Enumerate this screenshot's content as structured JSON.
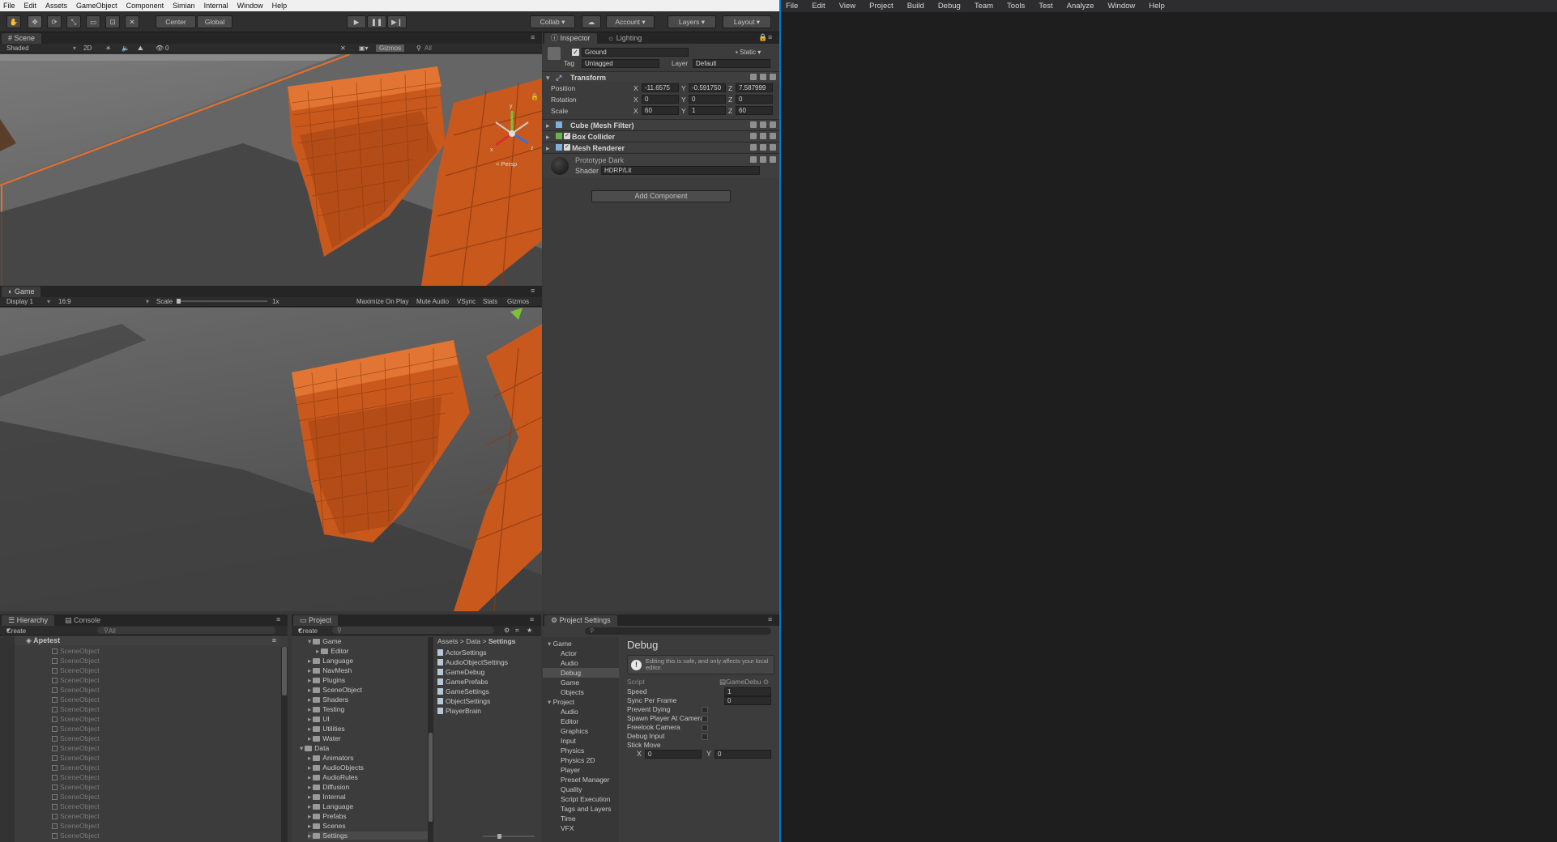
{
  "unity_menu": [
    "File",
    "Edit",
    "Assets",
    "GameObject",
    "Component",
    "Simian",
    "Internal",
    "Window",
    "Help"
  ],
  "toolbar": {
    "pivot": "Center",
    "space": "Global",
    "collab": "Collab",
    "account": "Account",
    "layers": "Layers",
    "layout": "Layout"
  },
  "scene": {
    "tab": "Scene",
    "shading": "Shaded",
    "mode_2d": "2D",
    "gizmos": "Gizmos",
    "search": "All",
    "persp": "Persp",
    "layer_count": "0",
    "axes": [
      "y",
      "x",
      "z"
    ]
  },
  "game": {
    "tab": "Game",
    "display": "Display 1",
    "aspect": "16:9",
    "scale_label": "Scale",
    "scale_value": "1x",
    "options": [
      "Maximize On Play",
      "Mute Audio",
      "VSync",
      "Stats",
      "Gizmos"
    ]
  },
  "inspector": {
    "tab": "Inspector",
    "tab2": "Lighting",
    "object_name": "Ground",
    "static_label": "Static",
    "tag_label": "Tag",
    "tag_value": "Untagged",
    "layer_label": "Layer",
    "layer_value": "Default",
    "transform": {
      "title": "Transform",
      "position_label": "Position",
      "rotation_label": "Rotation",
      "scale_label": "Scale",
      "position": [
        "-11.6575",
        "-0.591750",
        "7.587999"
      ],
      "rotation": [
        "0",
        "0",
        "0"
      ],
      "scale": [
        "60",
        "1",
        "60"
      ]
    },
    "components": [
      "Cube (Mesh Filter)",
      "Box Collider",
      "Mesh Renderer"
    ],
    "material_name": "Prototype Dark",
    "shader_label": "Shader",
    "shader_value": "HDRP/Lit",
    "add_component": "Add Component"
  },
  "hierarchy": {
    "tab": "Hierarchy",
    "tab2": "Console",
    "create": "Create",
    "search": "All",
    "scene_name": "Apetest",
    "items": [
      "SceneObject",
      "SceneObject",
      "SceneObject",
      "SceneObject",
      "SceneObject",
      "SceneObject",
      "SceneObject",
      "SceneObject",
      "SceneObject",
      "SceneObject",
      "SceneObject",
      "SceneObject",
      "SceneObject",
      "SceneObject",
      "SceneObject",
      "SceneObject",
      "SceneObject",
      "SceneObject",
      "SceneObject",
      "SceneObject"
    ]
  },
  "project": {
    "tab": "Project",
    "create": "Create",
    "tree": [
      {
        "label": "Game",
        "depth": 1
      },
      {
        "label": "Editor",
        "depth": 2
      },
      {
        "label": "Language",
        "depth": 1
      },
      {
        "label": "NavMesh",
        "depth": 1
      },
      {
        "label": "Plugins",
        "depth": 1
      },
      {
        "label": "SceneObject",
        "depth": 1
      },
      {
        "label": "Shaders",
        "depth": 1
      },
      {
        "label": "Testing",
        "depth": 1
      },
      {
        "label": "UI",
        "depth": 1
      },
      {
        "label": "Utilities",
        "depth": 1
      },
      {
        "label": "Water",
        "depth": 1
      },
      {
        "label": "Data",
        "depth": 0
      },
      {
        "label": "Animators",
        "depth": 1
      },
      {
        "label": "AudioObjects",
        "depth": 1
      },
      {
        "label": "AudioRules",
        "depth": 1
      },
      {
        "label": "Diffusion",
        "depth": 1
      },
      {
        "label": "Internal",
        "depth": 1
      },
      {
        "label": "Language",
        "depth": 1
      },
      {
        "label": "Prefabs",
        "depth": 1
      },
      {
        "label": "Scenes",
        "depth": 1
      },
      {
        "label": "Settings",
        "depth": 1
      }
    ],
    "breadcrumb": [
      "Assets",
      "Data",
      "Settings"
    ],
    "files": [
      "ActorSettings",
      "AudioObjectSettings",
      "GameDebug",
      "GamePrefabs",
      "GameSettings",
      "ObjectSettings",
      "PlayerBrain"
    ]
  },
  "project_settings": {
    "tab": "Project Settings",
    "nav": [
      {
        "label": "Game",
        "depth": 0
      },
      {
        "label": "Actor",
        "depth": 1
      },
      {
        "label": "Audio",
        "depth": 1
      },
      {
        "label": "Debug",
        "depth": 1
      },
      {
        "label": "Game",
        "depth": 1
      },
      {
        "label": "Objects",
        "depth": 1
      },
      {
        "label": "Project",
        "depth": 0
      },
      {
        "label": "Audio",
        "depth": 1
      },
      {
        "label": "Editor",
        "depth": 1
      },
      {
        "label": "Graphics",
        "depth": 1
      },
      {
        "label": "Input",
        "depth": 1
      },
      {
        "label": "Physics",
        "depth": 1
      },
      {
        "label": "Physics 2D",
        "depth": 1
      },
      {
        "label": "Player",
        "depth": 1
      },
      {
        "label": "Preset Manager",
        "depth": 1
      },
      {
        "label": "Quality",
        "depth": 1
      },
      {
        "label": "Script Execution",
        "depth": 1
      },
      {
        "label": "Tags and Layers",
        "depth": 1
      },
      {
        "label": "Time",
        "depth": 1
      },
      {
        "label": "VFX",
        "depth": 1
      }
    ],
    "title": "Debug",
    "notice": "Editing this is safe, and only affects your local editor.",
    "script_label": "Script",
    "script_value": "GameDebu",
    "fields": [
      {
        "label": "Speed",
        "value": "1"
      },
      {
        "label": "Sync Per Frame",
        "value": "0"
      },
      {
        "label": "Prevent Dying",
        "value": ""
      },
      {
        "label": "Spawn Player At Camera",
        "value": ""
      },
      {
        "label": "Freelook Camera",
        "value": ""
      },
      {
        "label": "Debug Input",
        "value": ""
      },
      {
        "label": "Stick Move",
        "value": ""
      }
    ],
    "stick_x": "0",
    "stick_y": "0"
  },
  "ide_menu": [
    "File",
    "Edit",
    "View",
    "Project",
    "Build",
    "Debug",
    "Team",
    "Tools",
    "Test",
    "Analyze",
    "Window",
    "Help"
  ],
  "colors": {
    "unity_bg": "#383838",
    "accent_orange": "#e8702a",
    "ide_bg": "#1e1e1e",
    "ide_accent": "#007acc"
  }
}
